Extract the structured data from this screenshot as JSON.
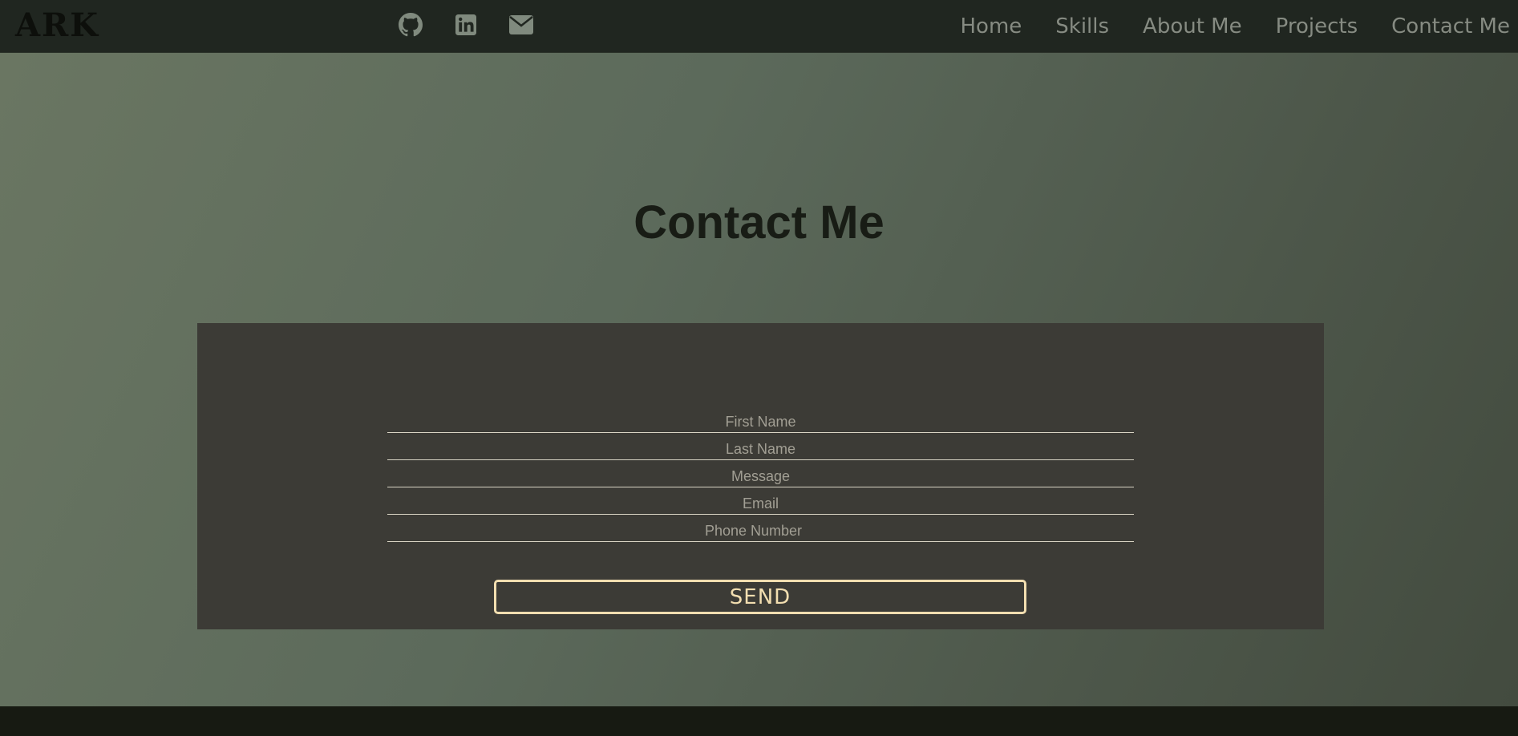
{
  "brand": {
    "logo_text": "ARK"
  },
  "social_icons": [
    "github-icon",
    "linkedin-icon",
    "envelope-icon"
  ],
  "nav": {
    "links": [
      "Home",
      "Skills",
      "About Me",
      "Projects",
      "Contact Me"
    ]
  },
  "contact": {
    "title": "Contact Me",
    "fields": {
      "first_name_placeholder": "First Name",
      "last_name_placeholder": "Last Name",
      "message_placeholder": "Message",
      "email_placeholder": "Email",
      "phone_placeholder": "Phone Number"
    },
    "send_label": "SEND"
  },
  "colors": {
    "navbar_bg": "#202620",
    "nav_text": "#868b82",
    "panel_bg": "#3c3b36",
    "accent": "#f2deb0",
    "title_text": "#181c15",
    "footer_bg": "#171a12"
  }
}
